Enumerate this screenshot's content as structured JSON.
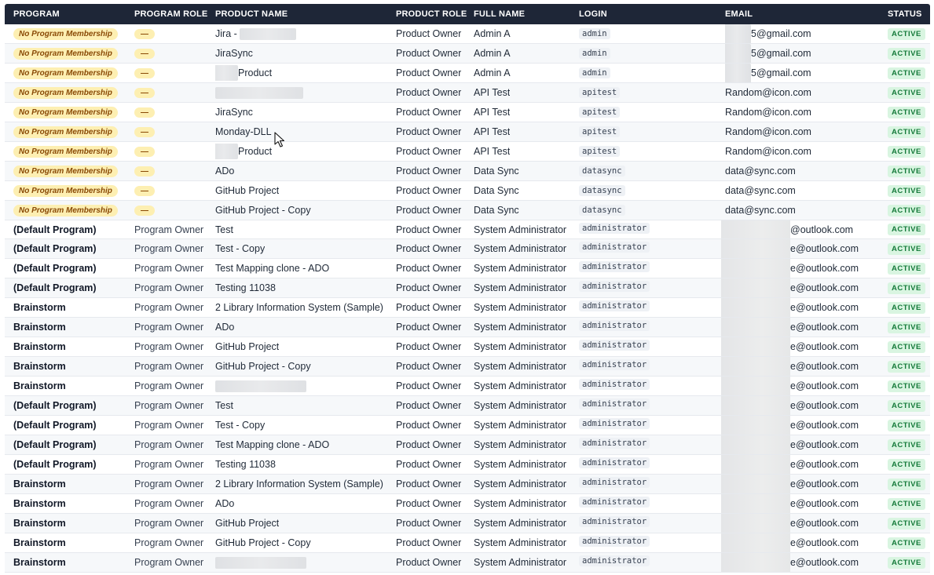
{
  "columns": {
    "program": "PROGRAM",
    "program_role": "PROGRAM ROLE",
    "product_name": "PRODUCT NAME",
    "product_role": "PRODUCT ROLE",
    "full_name": "FULL NAME",
    "login": "LOGIN",
    "email": "EMAIL",
    "status": "STATUS"
  },
  "rows": [
    {
      "kind": "nm",
      "program": "No Program Membership",
      "role": "—",
      "product": "Jira -",
      "product_blur": "after",
      "product_role": "Product Owner",
      "full_name": "Admin A",
      "login": "admin",
      "email": "5@gmail.com",
      "email_blur": "short",
      "status": "ACTIVE"
    },
    {
      "kind": "nm",
      "program": "No Program Membership",
      "role": "—",
      "product": "JiraSync",
      "product_blur": "none",
      "product_role": "Product Owner",
      "full_name": "Admin A",
      "login": "admin",
      "email": "5@gmail.com",
      "email_blur": "short",
      "status": "ACTIVE"
    },
    {
      "kind": "nm",
      "program": "No Program Membership",
      "role": "—",
      "product": "Product",
      "product_blur": "before",
      "product_role": "Product Owner",
      "full_name": "Admin A",
      "login": "admin",
      "email": "5@gmail.com",
      "email_blur": "short",
      "status": "ACTIVE"
    },
    {
      "kind": "nm",
      "program": "No Program Membership",
      "role": "—",
      "product": "",
      "product_blur": "full",
      "product_role": "Product Owner",
      "full_name": "API Test",
      "login": "apitest",
      "email": "Random@icon.com",
      "email_blur": "none",
      "status": "ACTIVE"
    },
    {
      "kind": "nm",
      "program": "No Program Membership",
      "role": "—",
      "product": "JiraSync",
      "product_blur": "none",
      "product_role": "Product Owner",
      "full_name": "API Test",
      "login": "apitest",
      "email": "Random@icon.com",
      "email_blur": "none",
      "status": "ACTIVE"
    },
    {
      "kind": "nm",
      "program": "No Program Membership",
      "role": "—",
      "product": "Monday-DLL",
      "product_blur": "none",
      "product_role": "Product Owner",
      "full_name": "API Test",
      "login": "apitest",
      "email": "Random@icon.com",
      "email_blur": "none",
      "status": "ACTIVE"
    },
    {
      "kind": "nm",
      "program": "No Program Membership",
      "role": "—",
      "product": "Product",
      "product_blur": "before",
      "product_role": "Product Owner",
      "full_name": "API Test",
      "login": "apitest",
      "email": "Random@icon.com",
      "email_blur": "none",
      "status": "ACTIVE"
    },
    {
      "kind": "nm",
      "program": "No Program Membership",
      "role": "—",
      "product": "ADo",
      "product_blur": "none",
      "product_role": "Product Owner",
      "full_name": "Data Sync",
      "login": "datasync",
      "email": "data@sync.com",
      "email_blur": "none",
      "status": "ACTIVE"
    },
    {
      "kind": "nm",
      "program": "No Program Membership",
      "role": "—",
      "product": "GitHub Project",
      "product_blur": "none",
      "product_role": "Product Owner",
      "full_name": "Data Sync",
      "login": "datasync",
      "email": "data@sync.com",
      "email_blur": "none",
      "status": "ACTIVE"
    },
    {
      "kind": "nm",
      "program": "No Program Membership",
      "role": "—",
      "product": "GitHub Project - Copy",
      "product_blur": "none",
      "product_role": "Product Owner",
      "full_name": "Data Sync",
      "login": "datasync",
      "email": "data@sync.com",
      "email_blur": "none",
      "status": "ACTIVE"
    },
    {
      "kind": "pg",
      "program": "(Default Program)",
      "role": "Program Owner",
      "product": "Test",
      "product_blur": "none",
      "product_role": "Product Owner",
      "full_name": "System Administrator",
      "login": "administrator",
      "email": "@outlook.com",
      "email_blur": "long",
      "status": "ACTIVE"
    },
    {
      "kind": "pg",
      "program": "(Default Program)",
      "role": "Program Owner",
      "product": "Test - Copy",
      "product_blur": "none",
      "product_role": "Product Owner",
      "full_name": "System Administrator",
      "login": "administrator",
      "email": "e@outlook.com",
      "email_blur": "long",
      "status": "ACTIVE"
    },
    {
      "kind": "pg",
      "program": "(Default Program)",
      "role": "Program Owner",
      "product": "Test Mapping clone - ADO",
      "product_blur": "none",
      "product_role": "Product Owner",
      "full_name": "System Administrator",
      "login": "administrator",
      "email": "e@outlook.com",
      "email_blur": "long",
      "status": "ACTIVE"
    },
    {
      "kind": "pg",
      "program": "(Default Program)",
      "role": "Program Owner",
      "product": "Testing 11038",
      "product_blur": "none",
      "product_role": "Product Owner",
      "full_name": "System Administrator",
      "login": "administrator",
      "email": "e@outlook.com",
      "email_blur": "long",
      "status": "ACTIVE"
    },
    {
      "kind": "pg",
      "program": "Brainstorm",
      "role": "Program Owner",
      "product": "2 Library Information System (Sample)",
      "product_blur": "none",
      "product_role": "Product Owner",
      "full_name": "System Administrator",
      "login": "administrator",
      "email": "e@outlook.com",
      "email_blur": "long",
      "status": "ACTIVE"
    },
    {
      "kind": "pg",
      "program": "Brainstorm",
      "role": "Program Owner",
      "product": "ADo",
      "product_blur": "none",
      "product_role": "Product Owner",
      "full_name": "System Administrator",
      "login": "administrator",
      "email": "e@outlook.com",
      "email_blur": "long",
      "status": "ACTIVE"
    },
    {
      "kind": "pg",
      "program": "Brainstorm",
      "role": "Program Owner",
      "product": "GitHub Project",
      "product_blur": "none",
      "product_role": "Product Owner",
      "full_name": "System Administrator",
      "login": "administrator",
      "email": "e@outlook.com",
      "email_blur": "long",
      "status": "ACTIVE"
    },
    {
      "kind": "pg",
      "program": "Brainstorm",
      "role": "Program Owner",
      "product": "GitHub Project - Copy",
      "product_blur": "none",
      "product_role": "Product Owner",
      "full_name": "System Administrator",
      "login": "administrator",
      "email": "e@outlook.com",
      "email_blur": "long",
      "status": "ACTIVE"
    },
    {
      "kind": "pg",
      "program": "Brainstorm",
      "role": "Program Owner",
      "product": "",
      "product_blur": "full",
      "product_role": "Product Owner",
      "full_name": "System Administrator",
      "login": "administrator",
      "email": "e@outlook.com",
      "email_blur": "long",
      "status": "ACTIVE"
    },
    {
      "kind": "pg",
      "program": "(Default Program)",
      "role": "Program Owner",
      "product": "Test",
      "product_blur": "none",
      "product_role": "Product Owner",
      "full_name": "System Administrator",
      "login": "administrator",
      "email": "e@outlook.com",
      "email_blur": "long",
      "status": "ACTIVE"
    },
    {
      "kind": "pg",
      "program": "(Default Program)",
      "role": "Program Owner",
      "product": "Test - Copy",
      "product_blur": "none",
      "product_role": "Product Owner",
      "full_name": "System Administrator",
      "login": "administrator",
      "email": "e@outlook.com",
      "email_blur": "long",
      "status": "ACTIVE"
    },
    {
      "kind": "pg",
      "program": "(Default Program)",
      "role": "Program Owner",
      "product": "Test Mapping clone - ADO",
      "product_blur": "none",
      "product_role": "Product Owner",
      "full_name": "System Administrator",
      "login": "administrator",
      "email": "e@outlook.com",
      "email_blur": "long",
      "status": "ACTIVE"
    },
    {
      "kind": "pg",
      "program": "(Default Program)",
      "role": "Program Owner",
      "product": "Testing 11038",
      "product_blur": "none",
      "product_role": "Product Owner",
      "full_name": "System Administrator",
      "login": "administrator",
      "email": "e@outlook.com",
      "email_blur": "long",
      "status": "ACTIVE"
    },
    {
      "kind": "pg",
      "program": "Brainstorm",
      "role": "Program Owner",
      "product": "2 Library Information System (Sample)",
      "product_blur": "none",
      "product_role": "Product Owner",
      "full_name": "System Administrator",
      "login": "administrator",
      "email": "e@outlook.com",
      "email_blur": "long",
      "status": "ACTIVE"
    },
    {
      "kind": "pg",
      "program": "Brainstorm",
      "role": "Program Owner",
      "product": "ADo",
      "product_blur": "none",
      "product_role": "Product Owner",
      "full_name": "System Administrator",
      "login": "administrator",
      "email": "e@outlook.com",
      "email_blur": "long",
      "status": "ACTIVE"
    },
    {
      "kind": "pg",
      "program": "Brainstorm",
      "role": "Program Owner",
      "product": "GitHub Project",
      "product_blur": "none",
      "product_role": "Product Owner",
      "full_name": "System Administrator",
      "login": "administrator",
      "email": "e@outlook.com",
      "email_blur": "long",
      "status": "ACTIVE"
    },
    {
      "kind": "pg",
      "program": "Brainstorm",
      "role": "Program Owner",
      "product": "GitHub Project - Copy",
      "product_blur": "none",
      "product_role": "Product Owner",
      "full_name": "System Administrator",
      "login": "administrator",
      "email": "e@outlook.com",
      "email_blur": "long",
      "status": "ACTIVE"
    },
    {
      "kind": "pg",
      "program": "Brainstorm",
      "role": "Program Owner",
      "product": "",
      "product_blur": "full",
      "product_role": "Product Owner",
      "full_name": "System Administrator",
      "login": "administrator",
      "email": "e@outlook.com",
      "email_blur": "long",
      "status": "ACTIVE"
    }
  ],
  "colors": {
    "header_bg": "#1e2637",
    "no_membership_pill": "#fdefb2",
    "active_badge_bg": "#d9f5e1",
    "active_badge_text": "#157a3a"
  },
  "icons": {
    "cursor": "mouse-pointer-icon"
  }
}
